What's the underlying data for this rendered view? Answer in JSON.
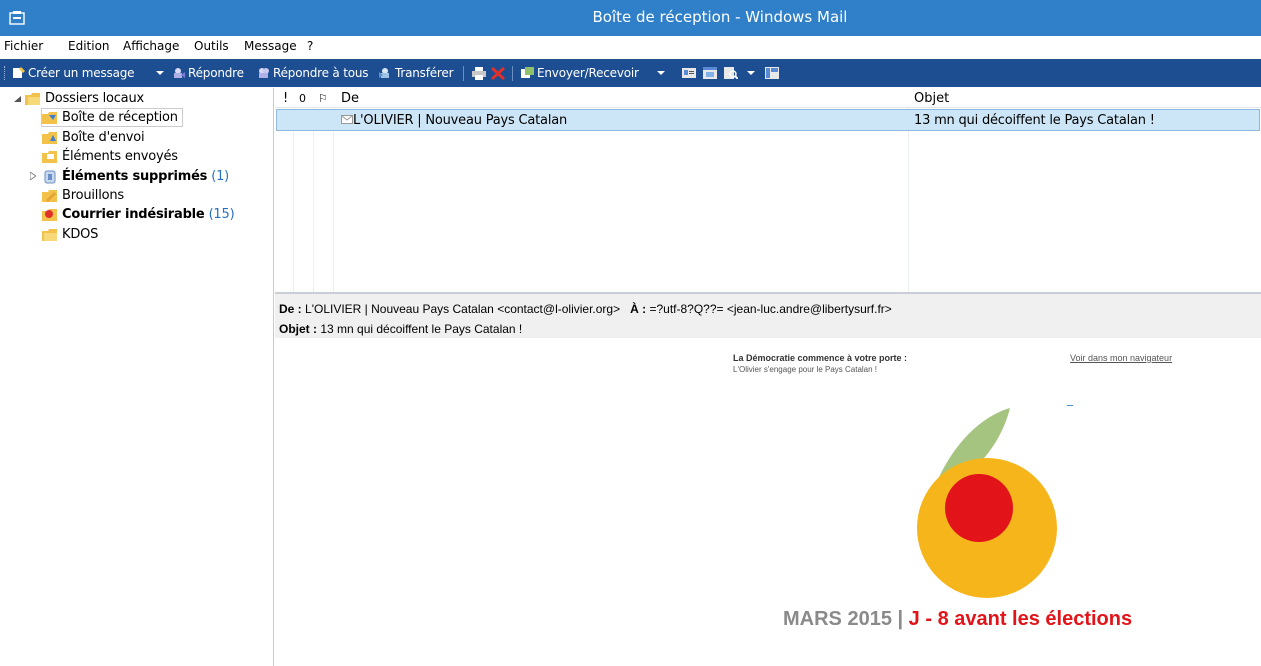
{
  "window": {
    "title": "Boîte de réception - Windows Mail"
  },
  "menu": {
    "items": [
      "Fichier",
      "Edition",
      "Affichage",
      "Outils",
      "Message",
      "?"
    ]
  },
  "toolbar": {
    "create": "Créer un message",
    "reply": "Répondre",
    "reply_all": "Répondre à tous",
    "forward": "Transférer",
    "send_receive": "Envoyer/Recevoir"
  },
  "folders": {
    "root": "Dossiers locaux",
    "items": [
      {
        "label": "Boîte de réception",
        "count": ""
      },
      {
        "label": "Boîte d'envoi",
        "count": ""
      },
      {
        "label": "Éléments envoyés",
        "count": ""
      },
      {
        "label": "Éléments supprimés",
        "count": "(1)"
      },
      {
        "label": "Brouillons",
        "count": ""
      },
      {
        "label": "Courrier indésirable",
        "count": "(15)"
      },
      {
        "label": "KDOS",
        "count": ""
      }
    ]
  },
  "message_list": {
    "columns": {
      "priority": "!",
      "attachment": "0",
      "flag": "⚐",
      "from": "De",
      "subject": "Objet"
    },
    "rows": [
      {
        "from": "L'OLIVIER | Nouveau Pays Catalan",
        "subject": "13 mn qui décoiffent le Pays Catalan !"
      }
    ]
  },
  "preview_header": {
    "from_label": "De :",
    "from_value": "L'OLIVIER | Nouveau Pays Catalan <contact@l-olivier.org>",
    "to_label": "À :",
    "to_value": "=?utf-8?Q??= <jean-luc.andre@libertysurf.fr>",
    "subject_label": "Objet :",
    "subject_value": "13 mn qui décoiffent le Pays Catalan !"
  },
  "email_body": {
    "tagline_title": "La Démocratie commence à votre porte :",
    "tagline_sub": "L'Olivier s'engage pour le Pays Catalan !",
    "view_link": "Voir dans mon navigateur",
    "headline_grey": "MARS 2015",
    "headline_sep": "|",
    "headline_red": "J - 8 avant les élections"
  },
  "colors": {
    "titlebar": "#2f80c9",
    "toolbar": "#1d4e91",
    "selection": "#cde6f7",
    "count": "#2b6fc2",
    "logo_leaf": "#a5c480",
    "logo_orange": "#f5b51b",
    "logo_red": "#e2141a"
  }
}
